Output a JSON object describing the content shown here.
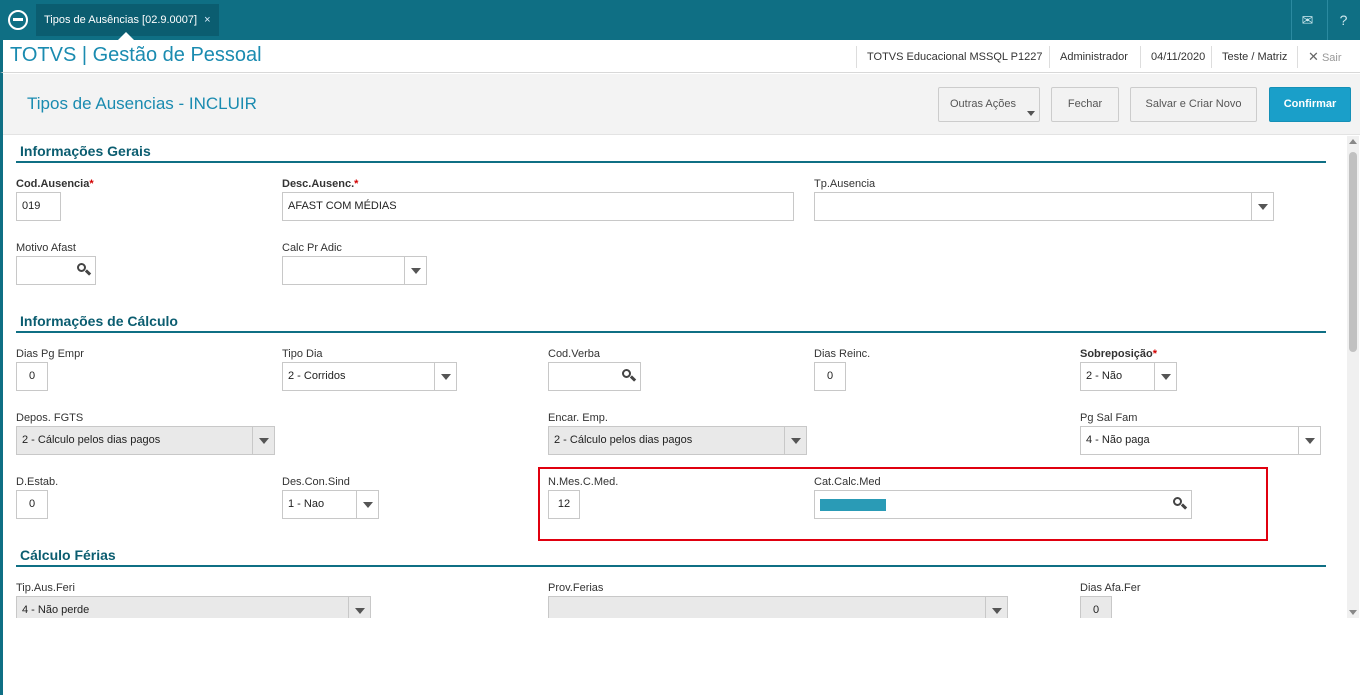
{
  "topbar": {
    "tab_title": "Tipos de Ausências [02.9.0007]",
    "tab_close": "×",
    "mail_icon": "mail-icon",
    "help_icon": "help-icon"
  },
  "header": {
    "brand": "TOTVS | Gestão de Pessoal",
    "environment": "TOTVS Educacional MSSQL P1227",
    "user": "Administrador",
    "date": "04/11/2020",
    "branch": "Teste / Matriz",
    "logout": "Sair"
  },
  "toolbar": {
    "title": "Tipos de Ausencias - INCLUIR",
    "other_actions": "Outras Ações",
    "close": "Fechar",
    "save_new": "Salvar e Criar Novo",
    "confirm": "Confirmar"
  },
  "sections": {
    "general": "Informações Gerais",
    "calculation": "Informações de Cálculo",
    "vacation": "Cálculo Férias"
  },
  "fields": {
    "cod_ausencia": {
      "label": "Cod.Ausencia",
      "value": "019",
      "required": "*"
    },
    "desc_ausenc": {
      "label": "Desc.Ausenc.",
      "value": "AFAST COM MÉDIAS",
      "required": "*"
    },
    "tp_ausencia": {
      "label": "Tp.Ausencia",
      "value": ""
    },
    "motivo_afast": {
      "label": "Motivo Afast",
      "value": ""
    },
    "calc_pr_adic": {
      "label": "Calc Pr Adic",
      "value": ""
    },
    "dias_pg_empr": {
      "label": "Dias Pg Empr",
      "value": "0"
    },
    "tipo_dia": {
      "label": "Tipo Dia",
      "value": "2 - Corridos"
    },
    "cod_verba": {
      "label": "Cod.Verba",
      "value": ""
    },
    "dias_reinc": {
      "label": "Dias Reinc.",
      "value": "0"
    },
    "sobreposicao": {
      "label": "Sobreposição",
      "value": "2 - Não",
      "required": "*"
    },
    "depos_fgts": {
      "label": "Depos. FGTS",
      "value": "2 - Cálculo pelos dias pagos"
    },
    "encar_emp": {
      "label": "Encar. Emp.",
      "value": "2 - Cálculo pelos dias pagos"
    },
    "pg_sal_fam": {
      "label": "Pg Sal Fam",
      "value": "4 - Não paga"
    },
    "d_estab": {
      "label": "D.Estab.",
      "value": "0"
    },
    "des_con_sind": {
      "label": "Des.Con.Sind",
      "value": "1 - Nao"
    },
    "n_mes_c_med": {
      "label": "N.Mes.C.Med.",
      "value": "12"
    },
    "cat_calc_med": {
      "label": "Cat.Calc.Med",
      "value": ""
    },
    "tip_aus_feri": {
      "label": "Tip.Aus.Feri",
      "value": "4 - Não perde"
    },
    "prov_ferias": {
      "label": "Prov.Ferias",
      "value": ""
    },
    "dias_afa_fer": {
      "label": "Dias Afa.Fer",
      "value": "0"
    }
  },
  "colors": {
    "topbar": "#0f6f84",
    "accent": "#1a8bb0",
    "confirm": "#1a9fc9",
    "highlight": "#e0000f"
  }
}
